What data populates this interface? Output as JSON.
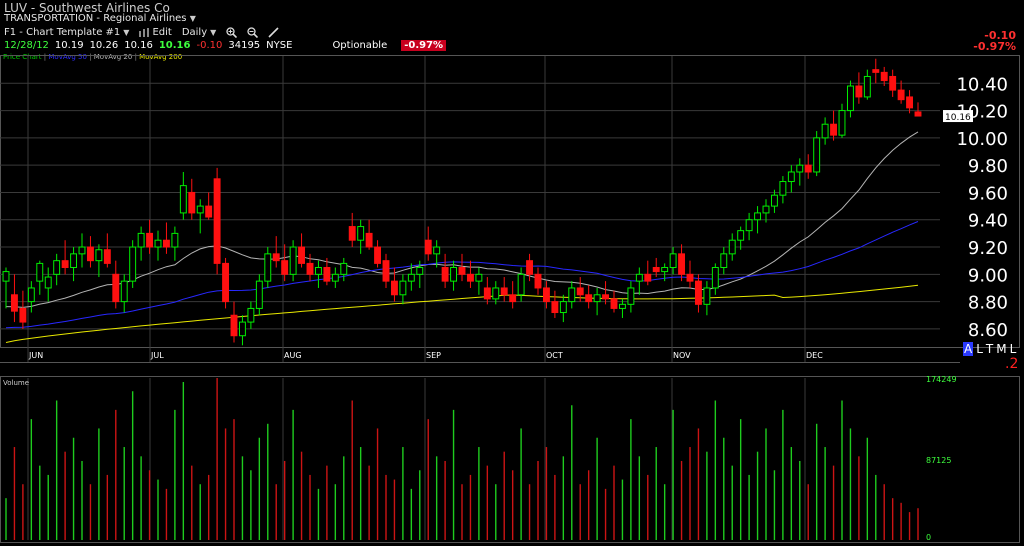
{
  "header": {
    "title": "LUV - Southwest Airlines Co",
    "sector": "TRANSPORTATION - Regional Airlines",
    "template": "F1 - Chart Template #1",
    "edit_label": "Edit",
    "period": "Daily",
    "quote": {
      "date": "12/28/12",
      "open": "10.19",
      "high": "10.26",
      "low": "10.16",
      "last": "10.16",
      "change": "-0.10",
      "volume": "34195",
      "exchange": "NYSE",
      "optionable": "Optionable",
      "change_pct": "-0.97%"
    },
    "right_change": "-0.10",
    "right_change_pct": "-0.97%"
  },
  "legend": {
    "price_chart": "Price Chart",
    "ma50": "MovAvg 50",
    "ma20": "MovAvg 20",
    "ma200": "MovAvg 200"
  },
  "controls": {
    "scale_a": "A",
    "scale_l": "L",
    "scale_t": "T",
    "scale_m": "M",
    "l": "L",
    "zoom": ".2"
  },
  "colors": {
    "up": "#00ee00",
    "down": "#ff1010",
    "ma20": "#b4b4b4",
    "ma50": "#2828ff",
    "ma200": "#e8e800",
    "grid": "#3a3a3a"
  },
  "chart_data": {
    "type": "candlestick",
    "title": "LUV - Southwest Airlines Co",
    "price_axis": {
      "ticks": [
        8.6,
        8.8,
        9.0,
        9.2,
        9.4,
        9.6,
        9.8,
        10.0,
        10.2,
        10.4
      ],
      "tick_labels": [
        "8.60",
        "8.80",
        "9.00",
        "9.20",
        "9.40",
        "9.60",
        "9.80",
        "10.00",
        "10.20",
        "10.40"
      ],
      "range": [
        8.46,
        10.6
      ]
    },
    "months": [
      "JUN",
      "JUL",
      "AUG",
      "SEP",
      "OCT",
      "NOV",
      "DEC"
    ],
    "last_price_label": "10.16",
    "volume_axis": {
      "ticks": [
        0,
        87125,
        174249
      ],
      "tick_labels": [
        "0",
        "87125",
        "174249"
      ]
    },
    "volume_title": "Volume",
    "candles": [
      {
        "o": 8.95,
        "h": 9.05,
        "l": 8.75,
        "c": 9.02
      },
      {
        "o": 8.85,
        "h": 9.0,
        "l": 8.65,
        "c": 8.73
      },
      {
        "o": 8.75,
        "h": 8.88,
        "l": 8.6,
        "c": 8.65
      },
      {
        "o": 8.8,
        "h": 8.95,
        "l": 8.72,
        "c": 8.9
      },
      {
        "o": 8.95,
        "h": 9.1,
        "l": 8.85,
        "c": 9.08
      },
      {
        "o": 8.9,
        "h": 9.05,
        "l": 8.8,
        "c": 8.98
      },
      {
        "o": 9.0,
        "h": 9.15,
        "l": 8.92,
        "c": 9.1
      },
      {
        "o": 9.1,
        "h": 9.25,
        "l": 9.0,
        "c": 9.05
      },
      {
        "o": 9.05,
        "h": 9.2,
        "l": 8.95,
        "c": 9.15
      },
      {
        "o": 9.15,
        "h": 9.3,
        "l": 9.05,
        "c": 9.2
      },
      {
        "o": 9.2,
        "h": 9.28,
        "l": 9.05,
        "c": 9.1
      },
      {
        "o": 9.1,
        "h": 9.22,
        "l": 8.98,
        "c": 9.18
      },
      {
        "o": 9.18,
        "h": 9.3,
        "l": 9.05,
        "c": 9.08
      },
      {
        "o": 9.0,
        "h": 9.1,
        "l": 8.75,
        "c": 8.8
      },
      {
        "o": 8.8,
        "h": 9.0,
        "l": 8.72,
        "c": 8.95
      },
      {
        "o": 8.95,
        "h": 9.25,
        "l": 8.9,
        "c": 9.2
      },
      {
        "o": 9.2,
        "h": 9.35,
        "l": 9.1,
        "c": 9.3
      },
      {
        "o": 9.3,
        "h": 9.4,
        "l": 9.15,
        "c": 9.2
      },
      {
        "o": 9.2,
        "h": 9.32,
        "l": 9.1,
        "c": 9.25
      },
      {
        "o": 9.25,
        "h": 9.38,
        "l": 9.15,
        "c": 9.2
      },
      {
        "o": 9.2,
        "h": 9.35,
        "l": 9.1,
        "c": 9.3
      },
      {
        "o": 9.45,
        "h": 9.75,
        "l": 9.4,
        "c": 9.65
      },
      {
        "o": 9.6,
        "h": 9.7,
        "l": 9.4,
        "c": 9.45
      },
      {
        "o": 9.45,
        "h": 9.55,
        "l": 9.3,
        "c": 9.5
      },
      {
        "o": 9.5,
        "h": 9.6,
        "l": 9.4,
        "c": 9.42
      },
      {
        "o": 9.7,
        "h": 9.78,
        "l": 9.0,
        "c": 9.08
      },
      {
        "o": 9.08,
        "h": 9.12,
        "l": 8.75,
        "c": 8.8
      },
      {
        "o": 8.7,
        "h": 8.8,
        "l": 8.5,
        "c": 8.55
      },
      {
        "o": 8.55,
        "h": 8.7,
        "l": 8.48,
        "c": 8.65
      },
      {
        "o": 8.65,
        "h": 8.8,
        "l": 8.6,
        "c": 8.75
      },
      {
        "o": 8.75,
        "h": 9.0,
        "l": 8.7,
        "c": 8.95
      },
      {
        "o": 8.95,
        "h": 9.2,
        "l": 8.9,
        "c": 9.15
      },
      {
        "o": 9.15,
        "h": 9.28,
        "l": 9.05,
        "c": 9.1
      },
      {
        "o": 9.1,
        "h": 9.22,
        "l": 8.95,
        "c": 9.0
      },
      {
        "o": 9.0,
        "h": 9.25,
        "l": 8.95,
        "c": 9.2
      },
      {
        "o": 9.2,
        "h": 9.3,
        "l": 9.05,
        "c": 9.08
      },
      {
        "o": 9.08,
        "h": 9.15,
        "l": 8.95,
        "c": 9.0
      },
      {
        "o": 9.0,
        "h": 9.1,
        "l": 8.9,
        "c": 9.05
      },
      {
        "o": 9.05,
        "h": 9.12,
        "l": 8.92,
        "c": 8.95
      },
      {
        "o": 8.95,
        "h": 9.05,
        "l": 8.9,
        "c": 9.0
      },
      {
        "o": 9.0,
        "h": 9.12,
        "l": 8.95,
        "c": 9.08
      },
      {
        "o": 9.35,
        "h": 9.45,
        "l": 9.2,
        "c": 9.25
      },
      {
        "o": 9.25,
        "h": 9.4,
        "l": 9.15,
        "c": 9.35
      },
      {
        "o": 9.3,
        "h": 9.4,
        "l": 9.18,
        "c": 9.2
      },
      {
        "o": 9.2,
        "h": 9.25,
        "l": 9.05,
        "c": 9.08
      },
      {
        "o": 9.1,
        "h": 9.15,
        "l": 8.9,
        "c": 8.95
      },
      {
        "o": 8.95,
        "h": 9.05,
        "l": 8.8,
        "c": 8.85
      },
      {
        "o": 8.85,
        "h": 9.0,
        "l": 8.78,
        "c": 8.95
      },
      {
        "o": 8.95,
        "h": 9.08,
        "l": 8.88,
        "c": 9.0
      },
      {
        "o": 9.0,
        "h": 9.1,
        "l": 8.9,
        "c": 9.05
      },
      {
        "o": 9.25,
        "h": 9.35,
        "l": 9.1,
        "c": 9.15
      },
      {
        "o": 9.15,
        "h": 9.25,
        "l": 9.05,
        "c": 9.2
      },
      {
        "o": 9.05,
        "h": 9.15,
        "l": 8.9,
        "c": 8.95
      },
      {
        "o": 8.95,
        "h": 9.1,
        "l": 8.88,
        "c": 9.05
      },
      {
        "o": 9.05,
        "h": 9.15,
        "l": 8.95,
        "c": 9.0
      },
      {
        "o": 9.0,
        "h": 9.1,
        "l": 8.9,
        "c": 8.95
      },
      {
        "o": 8.95,
        "h": 9.05,
        "l": 8.85,
        "c": 9.0
      },
      {
        "o": 8.9,
        "h": 8.98,
        "l": 8.78,
        "c": 8.82
      },
      {
        "o": 8.82,
        "h": 8.95,
        "l": 8.78,
        "c": 8.9
      },
      {
        "o": 8.9,
        "h": 8.98,
        "l": 8.8,
        "c": 8.85
      },
      {
        "o": 8.85,
        "h": 8.95,
        "l": 8.75,
        "c": 8.8
      },
      {
        "o": 8.85,
        "h": 9.05,
        "l": 8.8,
        "c": 9.0
      },
      {
        "o": 9.1,
        "h": 9.15,
        "l": 8.95,
        "c": 9.0
      },
      {
        "o": 9.0,
        "h": 9.05,
        "l": 8.85,
        "c": 8.9
      },
      {
        "o": 8.9,
        "h": 8.95,
        "l": 8.75,
        "c": 8.8
      },
      {
        "o": 8.8,
        "h": 8.88,
        "l": 8.68,
        "c": 8.72
      },
      {
        "o": 8.72,
        "h": 8.85,
        "l": 8.65,
        "c": 8.8
      },
      {
        "o": 8.8,
        "h": 8.95,
        "l": 8.75,
        "c": 8.9
      },
      {
        "o": 8.9,
        "h": 8.98,
        "l": 8.8,
        "c": 8.85
      },
      {
        "o": 8.85,
        "h": 8.92,
        "l": 8.75,
        "c": 8.8
      },
      {
        "o": 8.8,
        "h": 8.9,
        "l": 8.7,
        "c": 8.85
      },
      {
        "o": 8.85,
        "h": 8.95,
        "l": 8.78,
        "c": 8.82
      },
      {
        "o": 8.82,
        "h": 8.88,
        "l": 8.72,
        "c": 8.75
      },
      {
        "o": 8.75,
        "h": 8.82,
        "l": 8.68,
        "c": 8.78
      },
      {
        "o": 8.78,
        "h": 8.95,
        "l": 8.72,
        "c": 8.9
      },
      {
        "o": 8.95,
        "h": 9.05,
        "l": 8.85,
        "c": 9.0
      },
      {
        "o": 9.0,
        "h": 9.1,
        "l": 8.92,
        "c": 8.95
      },
      {
        "o": 9.05,
        "h": 9.12,
        "l": 8.98,
        "c": 9.02
      },
      {
        "o": 9.02,
        "h": 9.08,
        "l": 8.95,
        "c": 9.05
      },
      {
        "o": 9.05,
        "h": 9.2,
        "l": 9.0,
        "c": 9.15
      },
      {
        "o": 9.15,
        "h": 9.22,
        "l": 8.95,
        "c": 9.0
      },
      {
        "o": 9.0,
        "h": 9.1,
        "l": 8.9,
        "c": 8.95
      },
      {
        "o": 8.95,
        "h": 9.0,
        "l": 8.72,
        "c": 8.78
      },
      {
        "o": 8.78,
        "h": 8.95,
        "l": 8.7,
        "c": 8.9
      },
      {
        "o": 8.9,
        "h": 9.08,
        "l": 8.85,
        "c": 9.05
      },
      {
        "o": 9.05,
        "h": 9.2,
        "l": 9.0,
        "c": 9.15
      },
      {
        "o": 9.15,
        "h": 9.3,
        "l": 9.1,
        "c": 9.25
      },
      {
        "o": 9.25,
        "h": 9.35,
        "l": 9.18,
        "c": 9.32
      },
      {
        "o": 9.32,
        "h": 9.45,
        "l": 9.25,
        "c": 9.4
      },
      {
        "o": 9.4,
        "h": 9.5,
        "l": 9.3,
        "c": 9.45
      },
      {
        "o": 9.45,
        "h": 9.55,
        "l": 9.38,
        "c": 9.5
      },
      {
        "o": 9.5,
        "h": 9.62,
        "l": 9.45,
        "c": 9.58
      },
      {
        "o": 9.58,
        "h": 9.72,
        "l": 9.52,
        "c": 9.68
      },
      {
        "o": 9.68,
        "h": 9.8,
        "l": 9.6,
        "c": 9.75
      },
      {
        "o": 9.75,
        "h": 9.85,
        "l": 9.65,
        "c": 9.8
      },
      {
        "o": 9.8,
        "h": 9.88,
        "l": 9.7,
        "c": 9.75
      },
      {
        "o": 9.75,
        "h": 10.05,
        "l": 9.72,
        "c": 10.0
      },
      {
        "o": 10.0,
        "h": 10.15,
        "l": 9.95,
        "c": 10.1
      },
      {
        "o": 10.1,
        "h": 10.2,
        "l": 9.98,
        "c": 10.02
      },
      {
        "o": 10.02,
        "h": 10.25,
        "l": 10.0,
        "c": 10.2
      },
      {
        "o": 10.2,
        "h": 10.42,
        "l": 10.15,
        "c": 10.38
      },
      {
        "o": 10.38,
        "h": 10.48,
        "l": 10.25,
        "c": 10.3
      },
      {
        "o": 10.3,
        "h": 10.5,
        "l": 10.28,
        "c": 10.45
      },
      {
        "o": 10.5,
        "h": 10.58,
        "l": 10.4,
        "c": 10.48
      },
      {
        "o": 10.48,
        "h": 10.52,
        "l": 10.38,
        "c": 10.42
      },
      {
        "o": 10.45,
        "h": 10.5,
        "l": 10.3,
        "c": 10.35
      },
      {
        "o": 10.35,
        "h": 10.42,
        "l": 10.25,
        "c": 10.28
      },
      {
        "o": 10.3,
        "h": 10.35,
        "l": 10.18,
        "c": 10.22
      },
      {
        "o": 10.19,
        "h": 10.26,
        "l": 10.16,
        "c": 10.16
      }
    ],
    "volumes": [
      {
        "v": 45000,
        "up": true
      },
      {
        "v": 100000,
        "up": false
      },
      {
        "v": 60000,
        "up": false
      },
      {
        "v": 130000,
        "up": true
      },
      {
        "v": 80000,
        "up": true
      },
      {
        "v": 70000,
        "up": true
      },
      {
        "v": 150000,
        "up": true
      },
      {
        "v": 95000,
        "up": false
      },
      {
        "v": 110000,
        "up": true
      },
      {
        "v": 85000,
        "up": true
      },
      {
        "v": 60000,
        "up": false
      },
      {
        "v": 120000,
        "up": true
      },
      {
        "v": 70000,
        "up": false
      },
      {
        "v": 140000,
        "up": false
      },
      {
        "v": 100000,
        "up": true
      },
      {
        "v": 160000,
        "up": true
      },
      {
        "v": 90000,
        "up": true
      },
      {
        "v": 75000,
        "up": false
      },
      {
        "v": 65000,
        "up": true
      },
      {
        "v": 55000,
        "up": false
      },
      {
        "v": 140000,
        "up": true
      },
      {
        "v": 170000,
        "up": true
      },
      {
        "v": 80000,
        "up": false
      },
      {
        "v": 60000,
        "up": true
      },
      {
        "v": 70000,
        "up": false
      },
      {
        "v": 174249,
        "up": false
      },
      {
        "v": 120000,
        "up": false
      },
      {
        "v": 130000,
        "up": false
      },
      {
        "v": 90000,
        "up": true
      },
      {
        "v": 75000,
        "up": true
      },
      {
        "v": 110000,
        "up": true
      },
      {
        "v": 125000,
        "up": true
      },
      {
        "v": 60000,
        "up": false
      },
      {
        "v": 85000,
        "up": false
      },
      {
        "v": 140000,
        "up": true
      },
      {
        "v": 95000,
        "up": false
      },
      {
        "v": 70000,
        "up": false
      },
      {
        "v": 55000,
        "up": true
      },
      {
        "v": 80000,
        "up": false
      },
      {
        "v": 60000,
        "up": true
      },
      {
        "v": 90000,
        "up": true
      },
      {
        "v": 150000,
        "up": false
      },
      {
        "v": 100000,
        "up": true
      },
      {
        "v": 80000,
        "up": false
      },
      {
        "v": 120000,
        "up": false
      },
      {
        "v": 70000,
        "up": false
      },
      {
        "v": 65000,
        "up": false
      },
      {
        "v": 100000,
        "up": true
      },
      {
        "v": 55000,
        "up": true
      },
      {
        "v": 75000,
        "up": true
      },
      {
        "v": 130000,
        "up": false
      },
      {
        "v": 90000,
        "up": true
      },
      {
        "v": 85000,
        "up": false
      },
      {
        "v": 140000,
        "up": true
      },
      {
        "v": 60000,
        "up": false
      },
      {
        "v": 70000,
        "up": false
      },
      {
        "v": 100000,
        "up": true
      },
      {
        "v": 80000,
        "up": false
      },
      {
        "v": 60000,
        "up": true
      },
      {
        "v": 95000,
        "up": false
      },
      {
        "v": 75000,
        "up": false
      },
      {
        "v": 120000,
        "up": true
      },
      {
        "v": 60000,
        "up": false
      },
      {
        "v": 85000,
        "up": false
      },
      {
        "v": 100000,
        "up": false
      },
      {
        "v": 70000,
        "up": false
      },
      {
        "v": 90000,
        "up": true
      },
      {
        "v": 145000,
        "up": true
      },
      {
        "v": 60000,
        "up": false
      },
      {
        "v": 75000,
        "up": false
      },
      {
        "v": 110000,
        "up": true
      },
      {
        "v": 55000,
        "up": false
      },
      {
        "v": 80000,
        "up": false
      },
      {
        "v": 65000,
        "up": true
      },
      {
        "v": 130000,
        "up": true
      },
      {
        "v": 90000,
        "up": true
      },
      {
        "v": 70000,
        "up": false
      },
      {
        "v": 100000,
        "up": true
      },
      {
        "v": 60000,
        "up": true
      },
      {
        "v": 140000,
        "up": true
      },
      {
        "v": 85000,
        "up": false
      },
      {
        "v": 100000,
        "up": false
      },
      {
        "v": 120000,
        "up": false
      },
      {
        "v": 95000,
        "up": true
      },
      {
        "v": 150000,
        "up": true
      },
      {
        "v": 110000,
        "up": true
      },
      {
        "v": 80000,
        "up": true
      },
      {
        "v": 130000,
        "up": true
      },
      {
        "v": 70000,
        "up": true
      },
      {
        "v": 95000,
        "up": true
      },
      {
        "v": 120000,
        "up": true
      },
      {
        "v": 75000,
        "up": true
      },
      {
        "v": 140000,
        "up": true
      },
      {
        "v": 100000,
        "up": true
      },
      {
        "v": 85000,
        "up": true
      },
      {
        "v": 60000,
        "up": false
      },
      {
        "v": 125000,
        "up": true
      },
      {
        "v": 100000,
        "up": true
      },
      {
        "v": 80000,
        "up": false
      },
      {
        "v": 150000,
        "up": true
      },
      {
        "v": 120000,
        "up": true
      },
      {
        "v": 90000,
        "up": false
      },
      {
        "v": 110000,
        "up": true
      },
      {
        "v": 70000,
        "up": true
      },
      {
        "v": 60000,
        "up": false
      },
      {
        "v": 45000,
        "up": false
      },
      {
        "v": 40000,
        "up": false
      },
      {
        "v": 30000,
        "up": false
      },
      {
        "v": 34195,
        "up": false
      }
    ]
  }
}
